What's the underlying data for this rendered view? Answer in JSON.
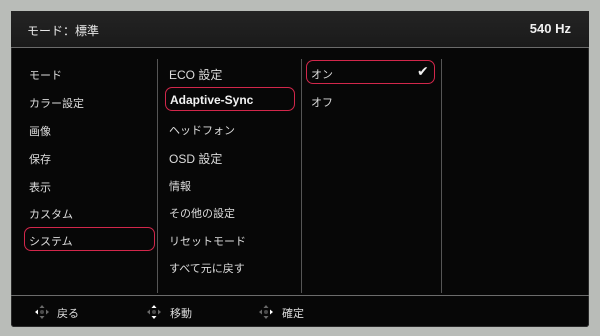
{
  "header": {
    "mode_label": "モード：標準",
    "refresh_rate": "540 Hz"
  },
  "menu": {
    "col1": [
      "モード",
      "カラー設定",
      "画像",
      "保存",
      "表示",
      "カスタム",
      "システム"
    ],
    "col2": [
      "ECO 設定",
      "Adaptive-Sync",
      "ヘッドフォン",
      "OSD 設定",
      "情報",
      "その他の設定",
      "リセットモード",
      "すべて元に戻す"
    ],
    "col3": [
      "オン",
      "オフ"
    ]
  },
  "footer": {
    "back": "戻る",
    "move": "移動",
    "confirm": "確定"
  },
  "colors": {
    "selection": "#d2274b"
  }
}
